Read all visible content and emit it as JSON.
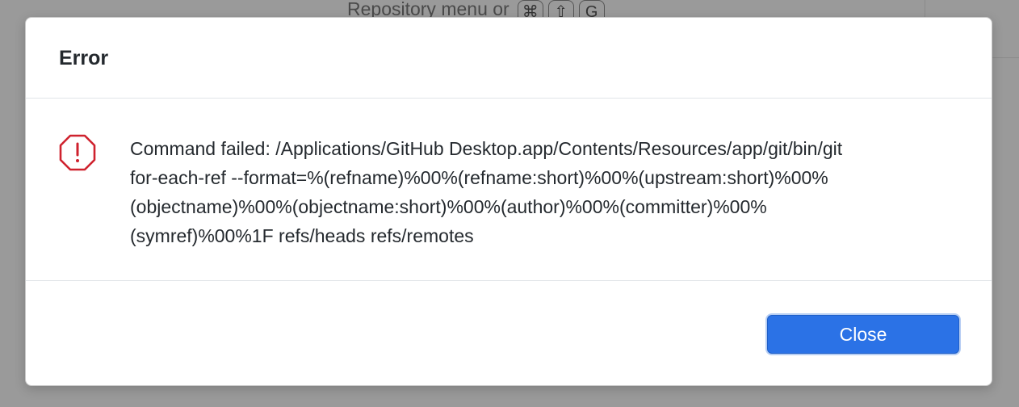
{
  "background": {
    "hint_text": "Repository menu or",
    "shortcut_keys": [
      "⌘",
      "⇧",
      "G"
    ]
  },
  "dialog": {
    "title": "Error",
    "message": "Command failed: /Applications/GitHub Desktop.app/Contents/Resources/app/git/bin/git for-each-ref --format=%(refname)%00%(refname:short)%00%(upstream:short)%00%(objectname)%00%(objectname:short)%00%(author)%00%(committer)%00%(symref)%00%1F refs/heads refs/remotes",
    "message_lines": [
      "Command failed: /Applications/GitHub Desktop.app/Contents/Resources/app/git/bin/git",
      "for-each-ref --format=%(refname)%00%(refname:short)%00%(upstream:short)%00%",
      "(objectname)%00%(objectname:short)%00%(author)%00%(committer)%00%",
      "(symref)%00%1F refs/heads refs/remotes"
    ],
    "icon": "error-octagon-icon",
    "close_label": "Close"
  },
  "colors": {
    "error_icon": "#cf222e",
    "primary_button": "#2b72e6",
    "overlay": "#9a9a9a"
  }
}
